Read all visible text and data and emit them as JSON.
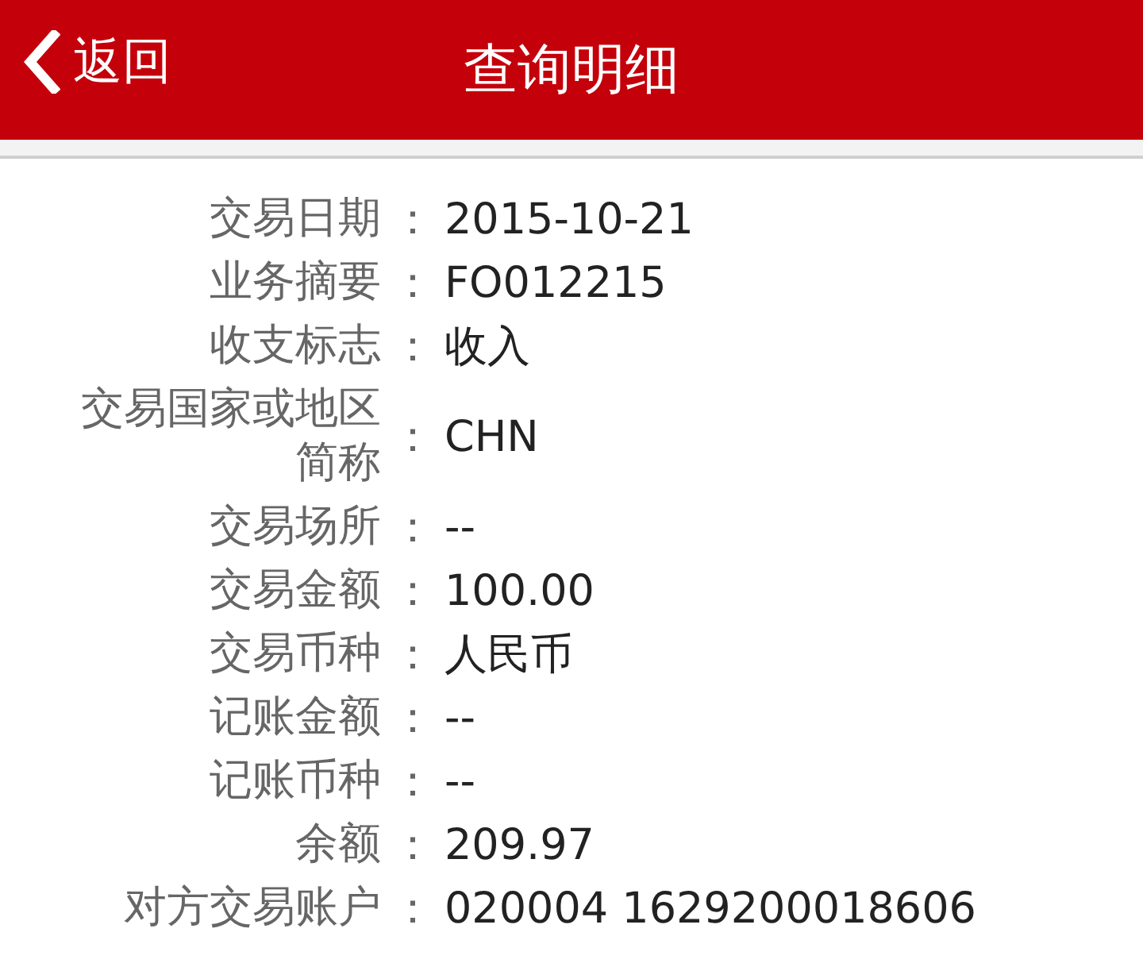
{
  "header": {
    "back": "返回",
    "title": "查询明细"
  },
  "details": [
    {
      "label": "交易日期",
      "value": "2015-10-21"
    },
    {
      "label": "业务摘要",
      "value": "FO012215"
    },
    {
      "label": "收支标志",
      "value": "收入"
    },
    {
      "label": "交易国家或地区简称",
      "value": "CHN"
    },
    {
      "label": "交易场所",
      "value": "--"
    },
    {
      "label": "交易金额",
      "value": "100.00"
    },
    {
      "label": "交易币种",
      "value": "人民币"
    },
    {
      "label": "记账金额",
      "value": "--"
    },
    {
      "label": "记账币种",
      "value": "--"
    },
    {
      "label": "余额",
      "value": "209.97"
    },
    {
      "label": "对方交易账户",
      "value": "020004 1629200018606"
    }
  ],
  "separator": "："
}
